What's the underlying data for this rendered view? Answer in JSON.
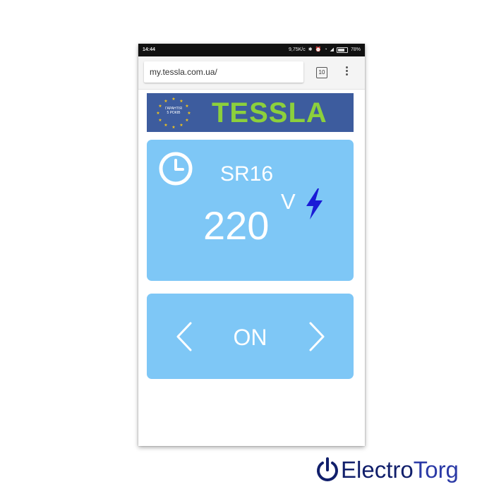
{
  "status_bar": {
    "time": "14:44",
    "network_speed": "9,75K/c",
    "battery": "78%",
    "battery_level": 0.78
  },
  "browser": {
    "url": "my.tessla.com.ua/",
    "tab_count": "10"
  },
  "banner": {
    "guarantee_line1": "ГАРАНТІЯ",
    "guarantee_line2": "5 РОКІВ",
    "brand": "TESSLA",
    "colors": {
      "background": "#3d5c9e",
      "brand": "#8cd03c",
      "stars": "#f5c518"
    }
  },
  "device": {
    "name": "SR16",
    "voltage": "220",
    "voltage_unit": "V",
    "icons": {
      "timer": "clock-icon",
      "power": "lightning-bolt-icon"
    }
  },
  "mode": {
    "value": "ON",
    "icons": {
      "prev": "chevron-left-icon",
      "next": "chevron-right-icon"
    }
  },
  "watermark": {
    "part1": "Electro",
    "part2": "Torg"
  },
  "colors": {
    "card": "#7ec7f6",
    "bolt": "#1a1ad6",
    "watermark": "#111f6b"
  }
}
